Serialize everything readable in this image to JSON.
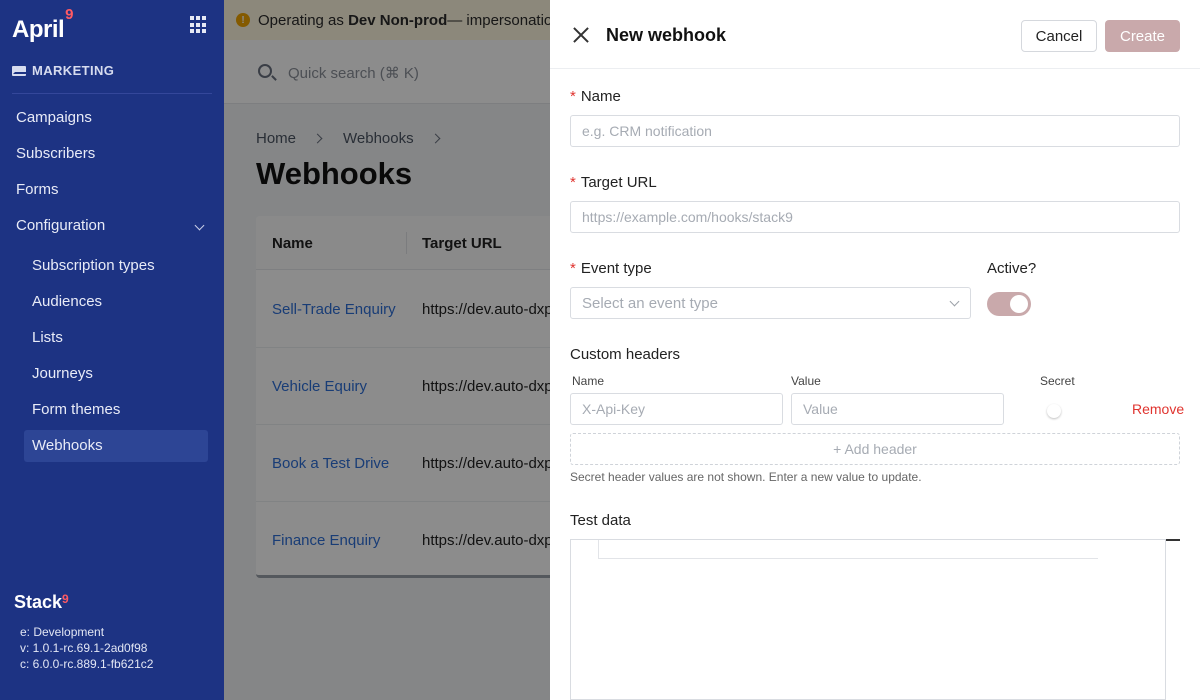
{
  "sidebar": {
    "brand": "April",
    "brand_sup": "9",
    "section": "MARKETING",
    "items": [
      {
        "label": "Campaigns"
      },
      {
        "label": "Subscribers"
      },
      {
        "label": "Forms"
      },
      {
        "label": "Configuration"
      }
    ],
    "sub_items": [
      {
        "label": "Subscription types"
      },
      {
        "label": "Audiences"
      },
      {
        "label": "Lists"
      },
      {
        "label": "Journeys"
      },
      {
        "label": "Form themes"
      },
      {
        "label": "Webhooks"
      }
    ],
    "footer": {
      "stack": "Stack",
      "stack_sup": "9",
      "env": "e: Development",
      "version": "v: 1.0.1-rc.69.1-2ad0f98",
      "core": "c: 6.0.0-rc.889.1-fb621c2"
    }
  },
  "banner": {
    "prefix": "Operating as ",
    "org": "Dev Non-prod",
    "suffix": " — impersonation"
  },
  "topbar": {
    "search_placeholder": "Quick search (⌘ K)"
  },
  "breadcrumb": {
    "home": "Home",
    "webhooks": "Webhooks"
  },
  "page": {
    "title": "Webhooks"
  },
  "table": {
    "headers": {
      "name": "Name",
      "target_url": "Target URL"
    },
    "rows": [
      {
        "name": "Sell-Trade Enquiry",
        "url": "https://dev.auto-dxp"
      },
      {
        "name": "Vehicle Equiry",
        "url": "https://dev.auto-dxp"
      },
      {
        "name": "Book a Test Drive",
        "url": "https://dev.auto-dxp"
      },
      {
        "name": "Finance Enquiry",
        "url": "https://dev.auto-dxp"
      }
    ]
  },
  "drawer": {
    "title": "New webhook",
    "cancel_label": "Cancel",
    "create_label": "Create",
    "name_label": "Name",
    "name_placeholder": "e.g. CRM notification",
    "url_label": "Target URL",
    "url_placeholder": "https://example.com/hooks/stack9",
    "event_label": "Event type",
    "event_placeholder": "Select an event type",
    "active_label": "Active?",
    "active": true,
    "headers_label": "Custom headers",
    "col_name": "Name",
    "col_value": "Value",
    "col_secret": "Secret",
    "header_name_placeholder": "X-Api-Key",
    "header_value_placeholder": "Value",
    "remove_label": "Remove",
    "add_header_label": "+ Add header",
    "hint": "Secret header values are not shown. Enter a new value to update.",
    "test_label": "Test data"
  },
  "colors": {
    "sidebar_bg": "#1d3383",
    "accent_disabled": "#c9a9ab",
    "link": "#2f6fd8",
    "danger": "#e0342f"
  }
}
